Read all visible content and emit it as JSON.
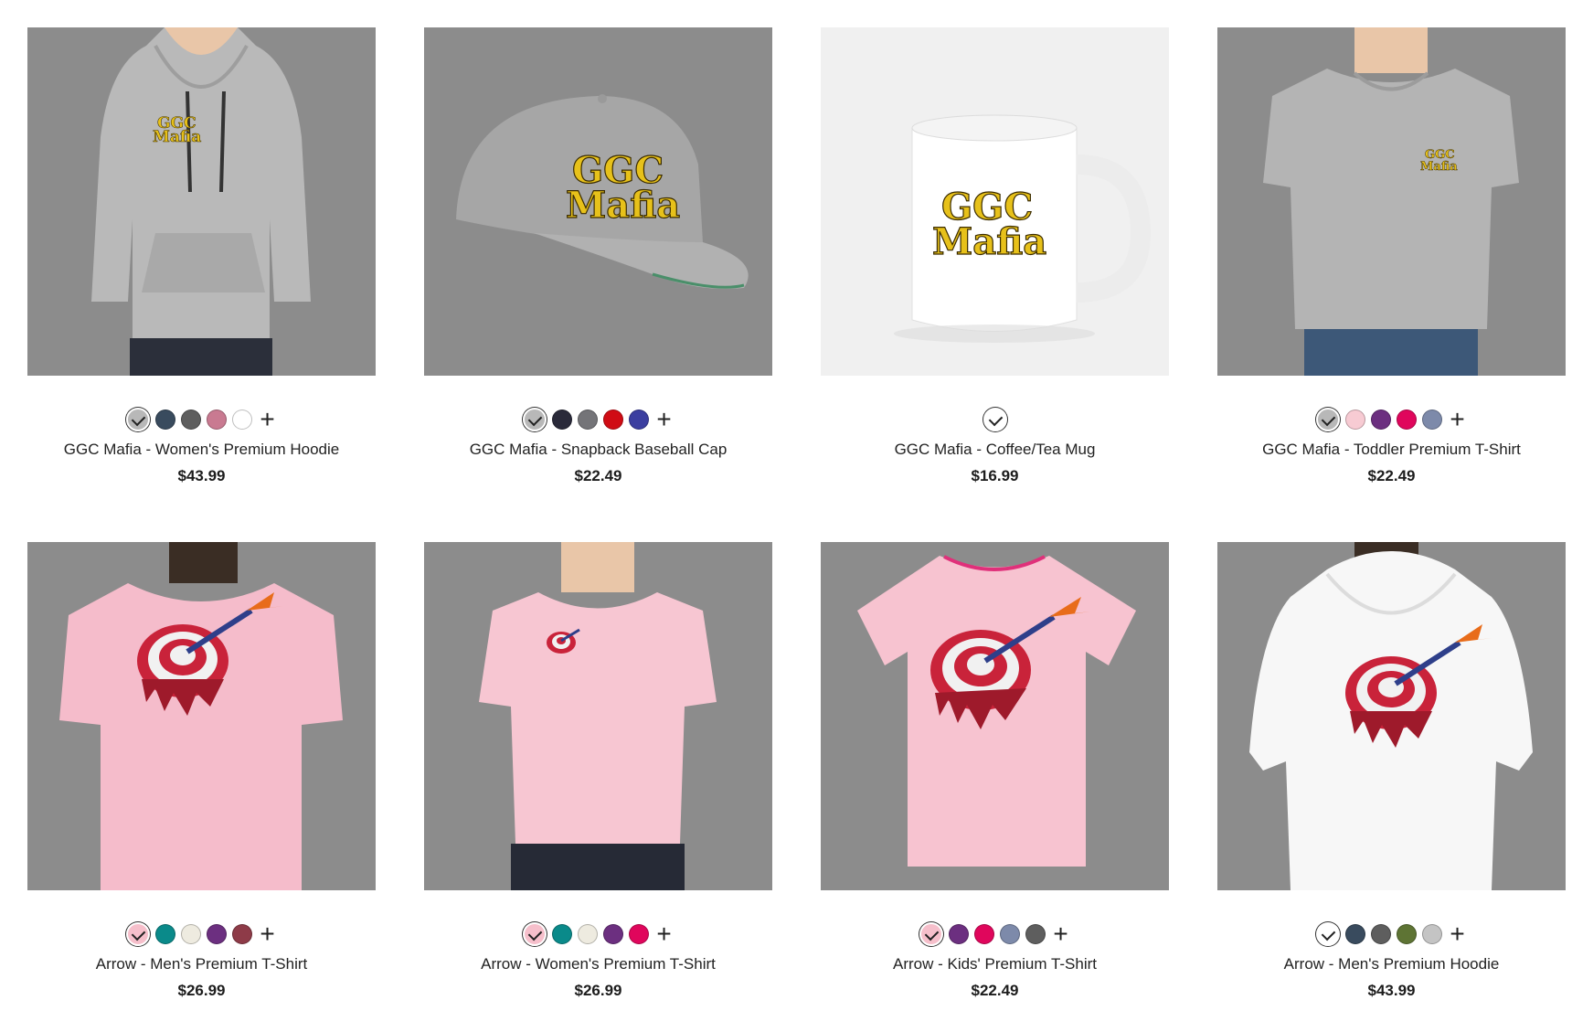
{
  "products": [
    {
      "title": "GGC Mafia - Women's Premium Hoodie",
      "price": "$43.99",
      "print_text": [
        "GGC",
        "Mafia"
      ],
      "swatches": [
        "#b8b8b8",
        "#394b5e",
        "#5e5e5e",
        "#c97a91",
        "#ffffff"
      ],
      "selected_swatch": 0,
      "more_label": "+"
    },
    {
      "title": "GGC Mafia - Snapback Baseball Cap",
      "price": "$22.49",
      "print_text": [
        "GGC",
        "Mafia"
      ],
      "swatches": [
        "#b8b8b8",
        "#2a2a3a",
        "#747478",
        "#d00c14",
        "#3b3ea0"
      ],
      "selected_swatch": 0,
      "more_label": "+"
    },
    {
      "title": "GGC Mafia - Coffee/Tea Mug",
      "price": "$16.99",
      "print_text": [
        "GGC",
        "Mafia"
      ],
      "swatches": [
        "#ffffff"
      ],
      "selected_swatch": 0,
      "more_label": ""
    },
    {
      "title": "GGC Mafia - Toddler Premium T-Shirt",
      "price": "$22.49",
      "print_text": [
        "GGC",
        "Mafia"
      ],
      "swatches": [
        "#b8b8b8",
        "#f7cbd3",
        "#6c2f80",
        "#e0065c",
        "#7d8aaa"
      ],
      "selected_swatch": 0,
      "more_label": "+"
    },
    {
      "title": "Arrow - Men's Premium T-Shirt",
      "price": "$26.99",
      "print_text": [],
      "swatches": [
        "#f6bfcb",
        "#0a8a8a",
        "#eeebe0",
        "#6c2f80",
        "#8e3b48"
      ],
      "selected_swatch": 0,
      "more_label": "+"
    },
    {
      "title": "Arrow - Women's Premium T-Shirt",
      "price": "$26.99",
      "print_text": [],
      "swatches": [
        "#f6bfcb",
        "#0a8a8a",
        "#eeebe0",
        "#6c2f80",
        "#e0065c"
      ],
      "selected_swatch": 0,
      "more_label": "+"
    },
    {
      "title": "Arrow - Kids' Premium T-Shirt",
      "price": "$22.49",
      "print_text": [],
      "swatches": [
        "#f6bfcb",
        "#6c2f80",
        "#e0065c",
        "#7d8aaa",
        "#5e5e5e"
      ],
      "selected_swatch": 0,
      "more_label": "+"
    },
    {
      "title": "Arrow - Men's Premium Hoodie",
      "price": "$43.99",
      "print_text": [],
      "swatches": [
        "#ffffff",
        "#394b5e",
        "#5e5e5e",
        "#5e7434",
        "#c4c4c4"
      ],
      "selected_swatch": 0,
      "more_label": "+"
    }
  ]
}
